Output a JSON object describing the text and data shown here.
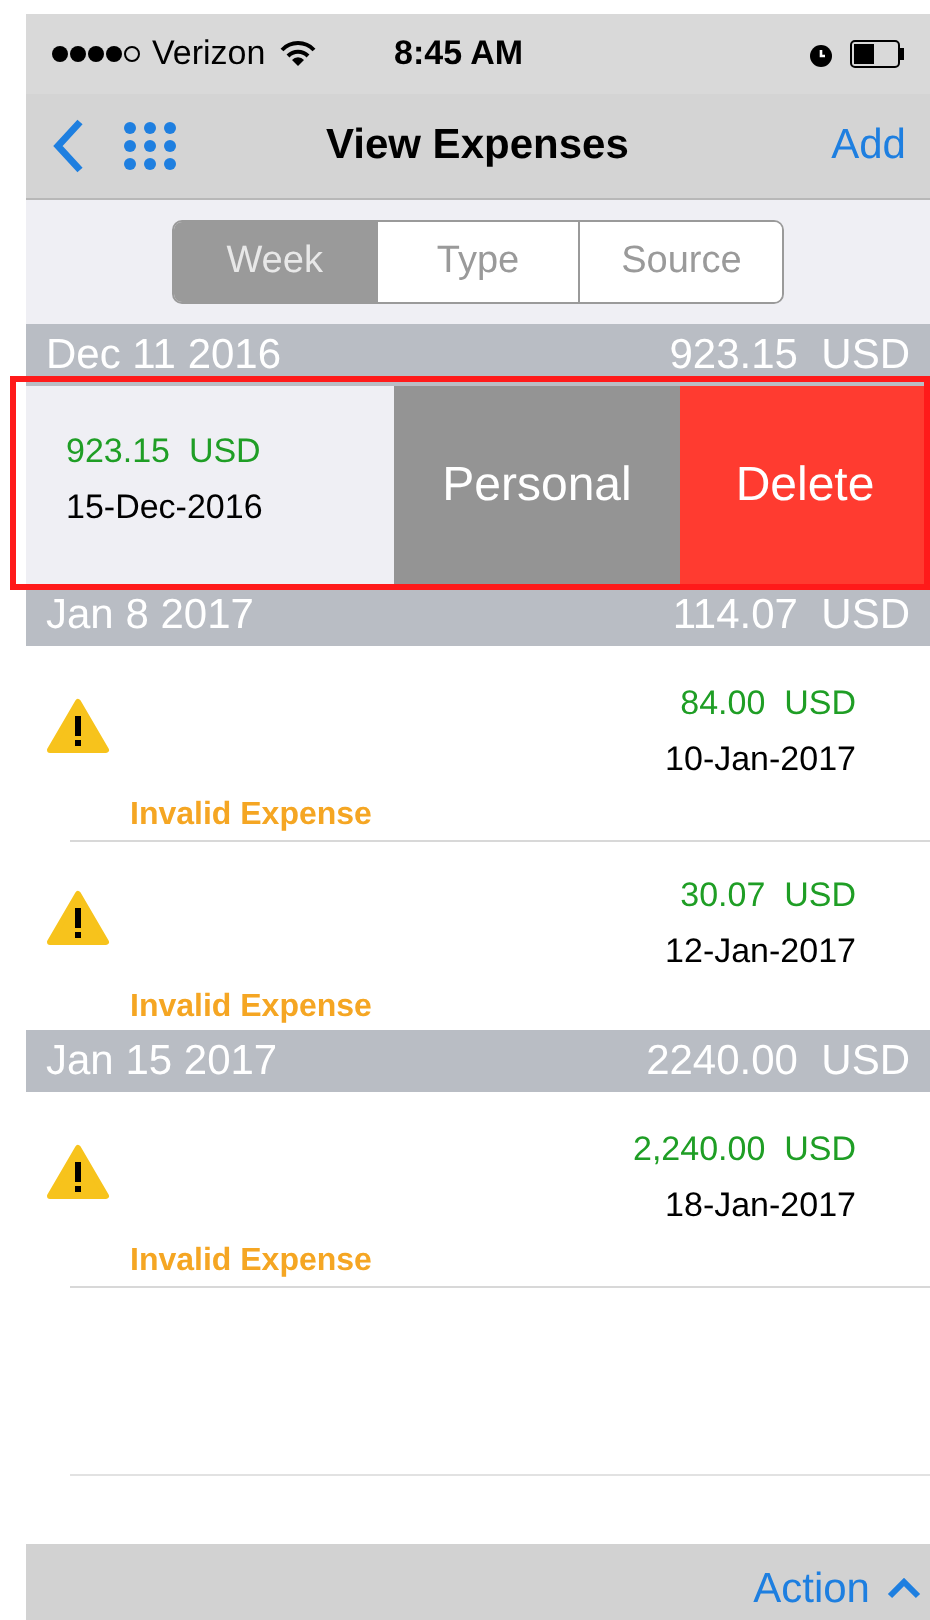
{
  "status_bar": {
    "carrier": "Verizon",
    "time": "8:45 AM"
  },
  "nav": {
    "title": "View Expenses",
    "add": "Add"
  },
  "segments": [
    {
      "label": "Week",
      "selected": true
    },
    {
      "label": "Type",
      "selected": false
    },
    {
      "label": "Source",
      "selected": false
    }
  ],
  "sections": [
    {
      "date": "Dec 11 2016",
      "total": "923.15  USD",
      "rows": [
        {
          "kind": "swiped",
          "amount": "923.15  USD",
          "date": "15-Dec-2016",
          "actions": [
            {
              "label": "Personal",
              "kind": "neutral"
            },
            {
              "label": "Delete",
              "kind": "destructive"
            }
          ]
        }
      ]
    },
    {
      "date": "Jan 8 2017",
      "total": "114.07  USD",
      "rows": [
        {
          "kind": "invalid",
          "amount": "84.00  USD",
          "date": "10-Jan-2017",
          "warning": "Invalid Expense"
        },
        {
          "kind": "invalid",
          "amount": "30.07  USD",
          "date": "12-Jan-2017",
          "warning": "Invalid Expense"
        }
      ]
    },
    {
      "date": "Jan 15 2017",
      "total": "2240.00  USD",
      "rows": [
        {
          "kind": "invalid",
          "amount": "2,240.00  USD",
          "date": "18-Jan-2017",
          "warning": "Invalid Expense"
        }
      ]
    }
  ],
  "footer": {
    "action": "Action"
  }
}
